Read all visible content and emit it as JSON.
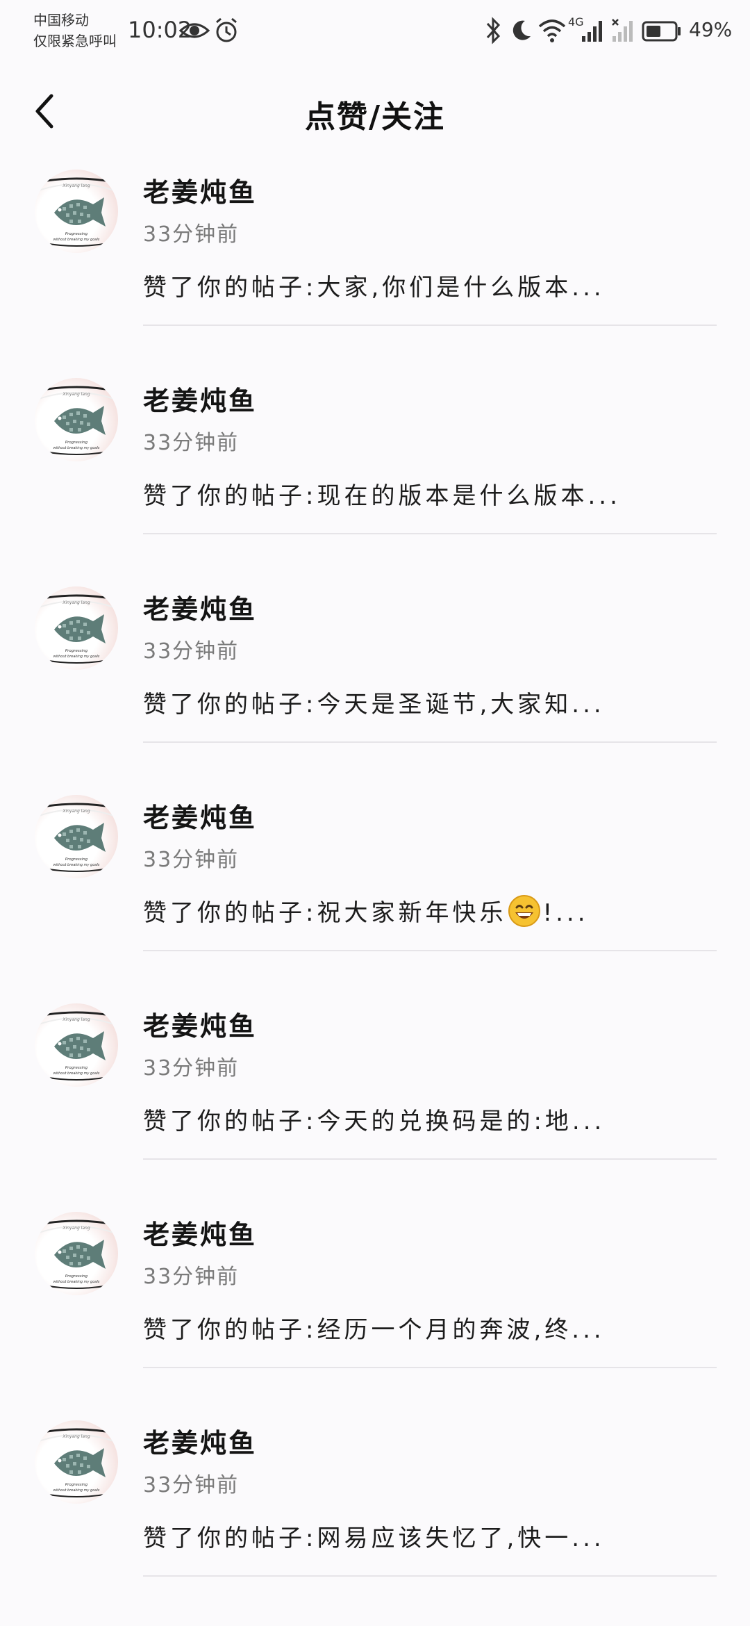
{
  "status_bar": {
    "carrier_line1": "中国移动",
    "carrier_line2": "仅限紧急呼叫",
    "time": "10:02",
    "network_type": "4G",
    "battery_percent": "49%"
  },
  "header": {
    "title": "点赞/关注"
  },
  "avatar": {
    "logo_text": [
      "Xinyang lang",
      "Progressing",
      "without breaking my goals"
    ]
  },
  "notifications": [
    {
      "user": "老姜炖鱼",
      "time": "33分钟前",
      "text": "赞了你的帖子:大家,你们是什么版本..."
    },
    {
      "user": "老姜炖鱼",
      "time": "33分钟前",
      "text": "赞了你的帖子:现在的版本是什么版本..."
    },
    {
      "user": "老姜炖鱼",
      "time": "33分钟前",
      "text": "赞了你的帖子:今天是圣诞节,大家知..."
    },
    {
      "user": "老姜炖鱼",
      "time": "33分钟前",
      "text_before": "赞了你的帖子:祝大家新年快乐",
      "text_after": "!...",
      "emoji": "grinning-face-icon"
    },
    {
      "user": "老姜炖鱼",
      "time": "33分钟前",
      "text": "赞了你的帖子:今天的兑换码是的:地..."
    },
    {
      "user": "老姜炖鱼",
      "time": "33分钟前",
      "text": "赞了你的帖子:经历一个月的奔波,终..."
    },
    {
      "user": "老姜炖鱼",
      "time": "33分钟前",
      "text": "赞了你的帖子:网易应该失忆了,快一..."
    }
  ]
}
